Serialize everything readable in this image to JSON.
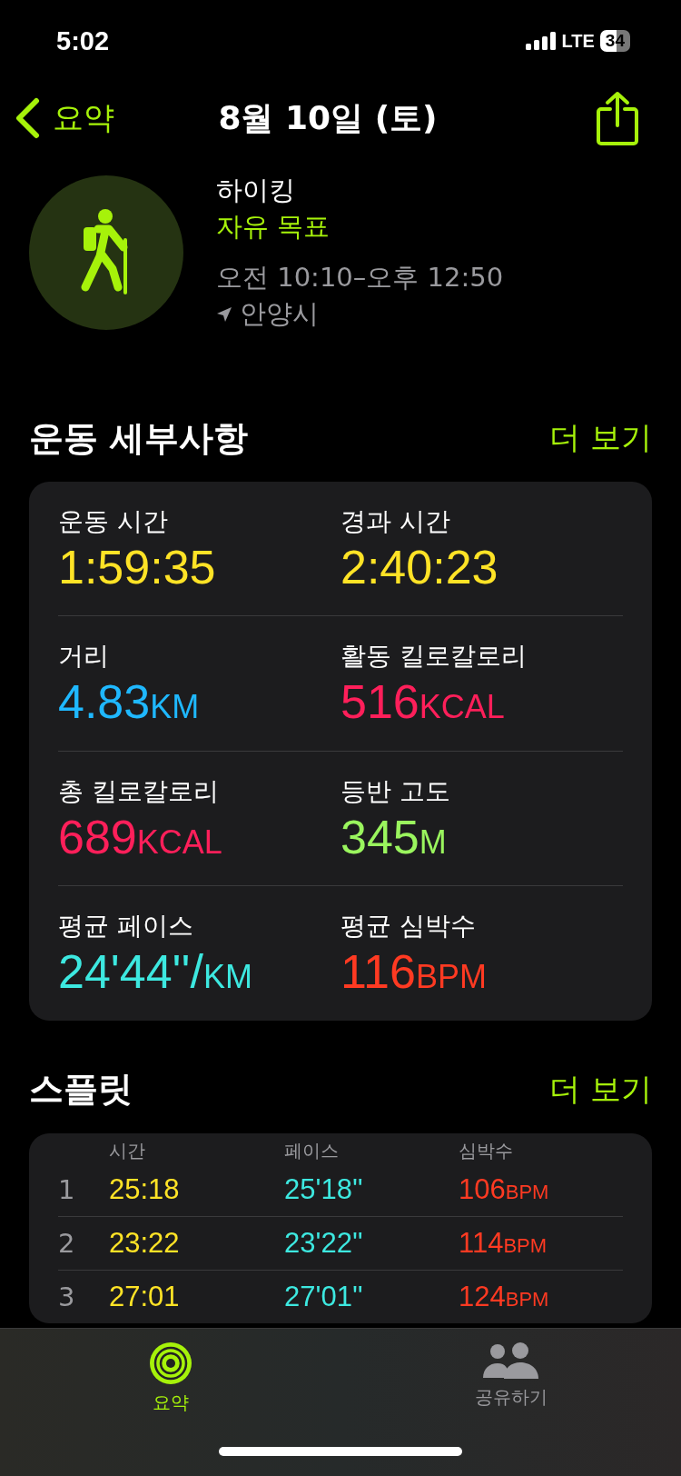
{
  "status_bar": {
    "time": "5:02",
    "network": "LTE",
    "battery": "34"
  },
  "nav": {
    "back_label": "요약",
    "title": "8월 10일 (토)"
  },
  "workout": {
    "name": "하이킹",
    "goal": "자유 목표",
    "time_range": "오전 10:10–오후 12:50",
    "location": "안양시"
  },
  "details": {
    "title": "운동 세부사항",
    "more": "더 보기",
    "metrics": [
      {
        "label": "운동 시간",
        "value": "1:59:35",
        "color": "#ffe326"
      },
      {
        "label": "경과 시간",
        "value": "2:40:23",
        "color": "#ffe326"
      },
      {
        "label": "거리",
        "value": "4.83",
        "unit": "KM",
        "color": "#1fb8ff"
      },
      {
        "label": "활동 킬로칼로리",
        "value": "516",
        "unit": "KCAL",
        "color": "#ff1f5a"
      },
      {
        "label": "총 킬로칼로리",
        "value": "689",
        "unit": "KCAL",
        "color": "#ff1f5a"
      },
      {
        "label": "등반 고도",
        "value": "345",
        "unit": "M",
        "color": "#9af55e"
      },
      {
        "label": "평균 페이스",
        "value": "24'44''/",
        "unit": "KM",
        "color": "#3de8e0"
      },
      {
        "label": "평균 심박수",
        "value": "116",
        "unit": "BPM",
        "color": "#ff3a22"
      }
    ]
  },
  "splits": {
    "title": "스플릿",
    "more": "더 보기",
    "columns": [
      "시간",
      "페이스",
      "심박수"
    ],
    "rows": [
      {
        "index": "1",
        "time": "25:18",
        "pace": "25'18''",
        "heart_rate": "106",
        "unit": "BPM"
      },
      {
        "index": "2",
        "time": "23:22",
        "pace": "23'22''",
        "heart_rate": "114",
        "unit": "BPM"
      },
      {
        "index": "3",
        "time": "27:01",
        "pace": "27'01''",
        "heart_rate": "124",
        "unit": "BPM"
      }
    ]
  },
  "tab_bar": [
    {
      "label": "요약",
      "kind": "rings",
      "selected": true
    },
    {
      "label": "공유하기",
      "kind": "people",
      "selected": false
    }
  ]
}
